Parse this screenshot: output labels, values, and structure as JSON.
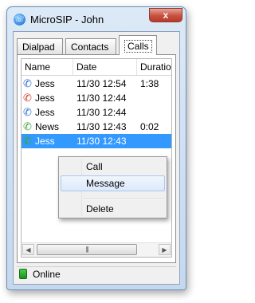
{
  "window": {
    "title": "MicroSIP - John",
    "close_label": "x"
  },
  "tabs": [
    {
      "label": "Dialpad"
    },
    {
      "label": "Contacts"
    },
    {
      "label": "Calls"
    }
  ],
  "calls": {
    "columns": [
      "Name",
      "Date",
      "Duration"
    ],
    "rows": [
      {
        "icon": "incoming-call-icon",
        "icon_color": "#2a6fd6",
        "name": "Jess",
        "date": "11/30 12:54",
        "duration": "1:38"
      },
      {
        "icon": "missed-call-icon",
        "icon_color": "#d23a2a",
        "name": "Jess",
        "date": "11/30 12:44",
        "duration": ""
      },
      {
        "icon": "incoming-call-icon",
        "icon_color": "#2a6fd6",
        "name": "Jess",
        "date": "11/30 12:44",
        "duration": ""
      },
      {
        "icon": "outgoing-call-icon",
        "icon_color": "#3aa832",
        "name": "News",
        "date": "11/30 12:43",
        "duration": "0:02"
      },
      {
        "icon": "outgoing-call-icon",
        "icon_color": "#3aa832",
        "name": "Jess",
        "date": "11/30 12:43",
        "duration": ""
      }
    ],
    "selected_row": 4
  },
  "context_menu": {
    "items": [
      "Call",
      "Message",
      "Delete"
    ],
    "highlighted": 1
  },
  "status": {
    "text": "Online",
    "icon": "online-status-icon",
    "color": "#2fb52f"
  },
  "colors": {
    "selection": "#3399ff",
    "accent": "#1c6fd0"
  }
}
